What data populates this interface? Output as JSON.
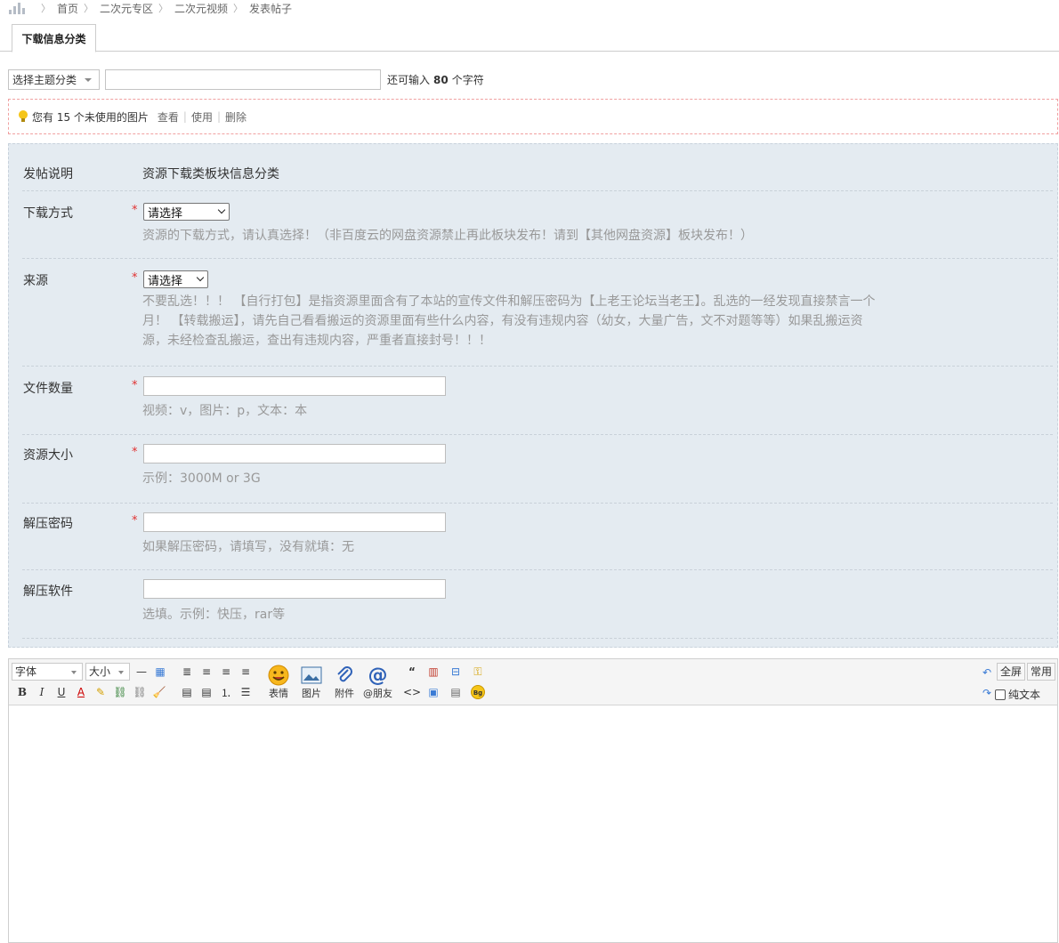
{
  "breadcrumb": [
    "首页",
    "二次元专区",
    "二次元视频",
    "发表帖子"
  ],
  "tab": {
    "label": "下载信息分类"
  },
  "subject": {
    "topic_select": "选择主题分类",
    "remain_prefix": "还可输入",
    "remain_count": "80",
    "remain_suffix": "个字符"
  },
  "notice": {
    "text": "您有 15 个未使用的图片",
    "view": "查看",
    "use": "使用",
    "delete": "删除"
  },
  "form": {
    "intro": {
      "label": "发帖说明",
      "value": "资源下载类板块信息分类"
    },
    "download_method": {
      "label": "下载方式",
      "required": "*",
      "selected": "请选择",
      "tip": "资源的下载方式，请认真选择！（非百度云的网盘资源禁止再此板块发布！请到【其他网盘资源】板块发布！）"
    },
    "source": {
      "label": "来源",
      "required": "*",
      "selected": "请选择",
      "tip": "不要乱选！！！ 【自行打包】是指资源里面含有了本站的宣传文件和解压密码为【上老王论坛当老王】。乱选的一经发现直接禁言一个月！ 【转载搬运】，请先自己看看搬运的资源里面有些什么内容，有没有违规内容（幼女，大量广告，文不对题等等）如果乱搬运资源，未经检查乱搬运，查出有违规内容，严重者直接封号！！！"
    },
    "file_count": {
      "label": "文件数量",
      "required": "*",
      "tip": "视频：v，图片：p，文本：本"
    },
    "size": {
      "label": "资源大小",
      "required": "*",
      "tip": "示例：3000M or 3G"
    },
    "password": {
      "label": "解压密码",
      "required": "*",
      "tip": "如果解压密码，请填写，没有就填：无"
    },
    "software": {
      "label": "解压软件",
      "tip": "选填。示例：快压，rar等"
    }
  },
  "editor": {
    "font": "字体",
    "size": "大小",
    "emoji": "表情",
    "image": "图片",
    "attach": "附件",
    "mention": "@朋友",
    "fullscreen": "全屏",
    "common": "常用",
    "plaintext": "纯文本"
  }
}
